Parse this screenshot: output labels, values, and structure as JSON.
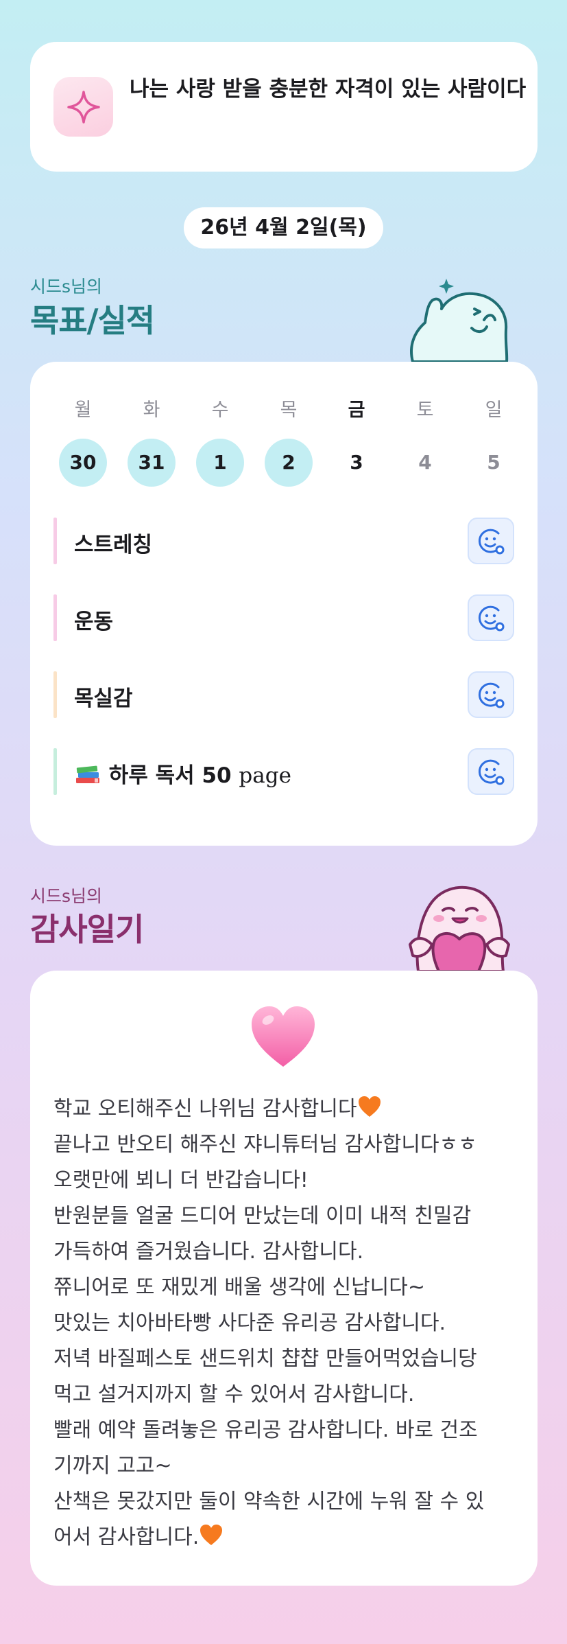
{
  "affirmation": {
    "text": "나는 사랑 받을 충분한 자격이 있는 사람이다",
    "icon": "sparkle-icon"
  },
  "date": {
    "label": "26년 4월 2일(목)"
  },
  "goals_section": {
    "subtitle": "시드s님의",
    "title": "목표/실적",
    "accent_color": "#257d82"
  },
  "week": {
    "days": [
      {
        "weekday": "월",
        "day": "30",
        "state": "done"
      },
      {
        "weekday": "화",
        "day": "31",
        "state": "done"
      },
      {
        "weekday": "수",
        "day": "1",
        "state": "done"
      },
      {
        "weekday": "목",
        "day": "2",
        "state": "done"
      },
      {
        "weekday": "금",
        "day": "3",
        "state": "today"
      },
      {
        "weekday": "토",
        "day": "4",
        "state": "future"
      },
      {
        "weekday": "일",
        "day": "5",
        "state": "future"
      }
    ]
  },
  "goals": [
    {
      "label": "스트레칭",
      "bar_color": "#f7cbe6",
      "icon": "smiley-check-icon"
    },
    {
      "label": "운동",
      "bar_color": "#f7cbe6",
      "icon": "smiley-check-icon"
    },
    {
      "label": "목실감",
      "bar_color": "#fbe3c7",
      "icon": "smiley-check-icon"
    },
    {
      "label": "하루 독서 50",
      "unit": "page",
      "prefix_icon": "books-icon",
      "bar_color": "#c6eedd",
      "icon": "smiley-check-icon"
    }
  ],
  "gratitude_section": {
    "subtitle": "시드s님의",
    "title": "감사일기",
    "accent_color": "#8a2f6c"
  },
  "gratitude": {
    "icon": "pink-heart-icon",
    "lines": [
      "학교 오티해주신 나위님 감사합니다",
      "끝나고 반오티 해주신 쟈니튜터님 감사합니다ㅎㅎ",
      "오랫만에 뵈니 더 반갑습니다!",
      "반원분들 얼굴 드디어 만났는데 이미 내적 친밀감",
      "가득하여 즐거웠습니다. 감사합니다.",
      "쮸니어로 또 재밌게 배울 생각에 신납니다~",
      "맛있는 치아바타빵 사다준 유리공 감사합니다.",
      "저녁 바질페스토 샌드위치 챱챱 만들어먹었습니당",
      "먹고 설거지까지 할 수 있어서 감사합니다.",
      "빨래 예약 돌려놓은 유리공 감사합니다. 바로 건조",
      "기까지 고고~",
      "산책은 못갔지만 둘이 약속한 시간에 누워 잘 수 있",
      "어서 감사합니다."
    ]
  }
}
